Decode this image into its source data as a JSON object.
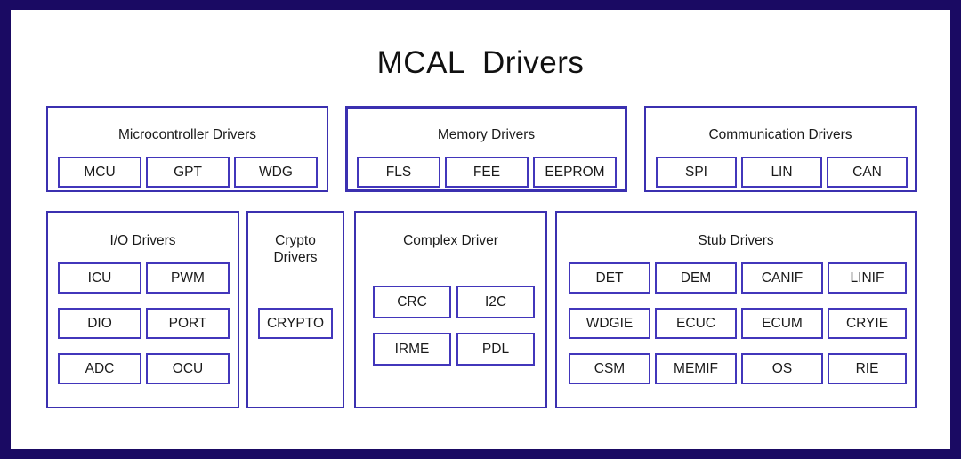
{
  "page": {
    "title": "MCAL  Drivers",
    "frame_color": "#1a0a63",
    "box_border_color": "#3b30b0",
    "cell_border_color": "#4236bb",
    "background": "#ffffff",
    "text_color": "#1a1a1a"
  },
  "groups": [
    {
      "id": "microcontroller-drivers",
      "title": "Microcontroller Drivers",
      "items": [
        "MCU",
        "GPT",
        "WDG"
      ]
    },
    {
      "id": "memory-drivers",
      "title": "Memory Drivers",
      "items": [
        "FLS",
        "FEE",
        "EEPROM"
      ]
    },
    {
      "id": "communication-drivers",
      "title": "Communication Drivers",
      "items": [
        "SPI",
        "LIN",
        "CAN"
      ]
    },
    {
      "id": "io-drivers",
      "title": "I/O Drivers",
      "items": [
        "ICU",
        "PWM",
        "DIO",
        "PORT",
        "ADC",
        "OCU"
      ]
    },
    {
      "id": "crypto-drivers",
      "title": "Crypto\nDrivers",
      "title_line1": "Crypto",
      "title_line2": "Drivers",
      "items": [
        "CRYPTO"
      ]
    },
    {
      "id": "complex-driver",
      "title": "Complex Driver",
      "items": [
        "CRC",
        "I2C",
        "IRME",
        "PDL"
      ]
    },
    {
      "id": "stub-drivers",
      "title": "Stub Drivers",
      "items": [
        "DET",
        "DEM",
        "CANIF",
        "LINIF",
        "WDGIE",
        "ECUC",
        "ECUM",
        "CRYIE",
        "CSM",
        "MEMIF",
        "OS",
        "RIE"
      ]
    }
  ]
}
